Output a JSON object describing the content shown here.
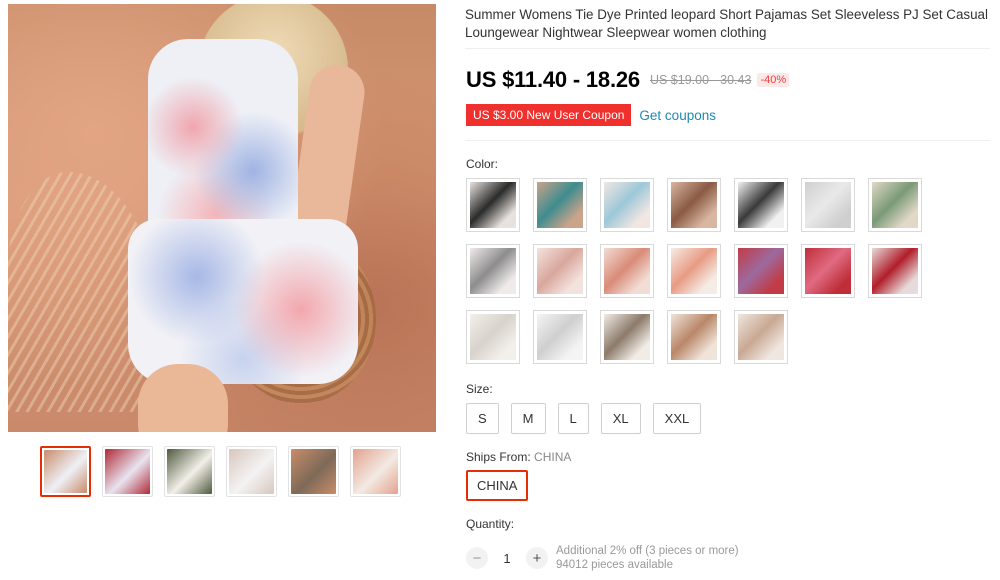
{
  "product": {
    "title": "Summer Womens Tie Dye Printed leopard Short Pajamas Set Sleeveless PJ Set Casual Loungewear Nightwear Sleepwear women clothing",
    "price": "US $11.40 - 18.26",
    "original_price": "US $19.00 - 30.43",
    "discount": "-40%",
    "coupon": "US $3.00 New User Coupon",
    "get_coupons": "Get coupons"
  },
  "color": {
    "label": "Color:",
    "swatches": [
      {
        "name": "black",
        "c1": "#2b2b2b",
        "c2": "#e7e2dd"
      },
      {
        "name": "teal",
        "c1": "#3f8c8f",
        "c2": "#c9a38a"
      },
      {
        "name": "blue-print",
        "c1": "#9cc8d8",
        "c2": "#f1e6e2"
      },
      {
        "name": "leopard",
        "c1": "#8a5a44",
        "c2": "#d8b6a1"
      },
      {
        "name": "black-white",
        "c1": "#3a3a3a",
        "c2": "#f1f1f1"
      },
      {
        "name": "white",
        "c1": "#e9e9e9",
        "c2": "#cfcfcf"
      },
      {
        "name": "green-leaf",
        "c1": "#7a9a76",
        "c2": "#e2d8c8"
      },
      {
        "name": "grey-print",
        "c1": "#8d8d8d",
        "c2": "#f0eaea"
      },
      {
        "name": "pink-leopard",
        "c1": "#d9a79c",
        "c2": "#f3e3de"
      },
      {
        "name": "salmon",
        "c1": "#d98b78",
        "c2": "#f2ddd5"
      },
      {
        "name": "coral",
        "c1": "#e79b83",
        "c2": "#f6ece6"
      },
      {
        "name": "tie-dye-purple",
        "c1": "#9c6a9e",
        "c2": "#c23b46"
      },
      {
        "name": "pink-floral",
        "c1": "#e06b82",
        "c2": "#bf2f3a"
      },
      {
        "name": "red",
        "c1": "#b01e2a",
        "c2": "#e7dada"
      },
      {
        "name": "white-print",
        "c1": "#d7d2cc",
        "c2": "#f3efea"
      },
      {
        "name": "light-grey",
        "c1": "#cfcfcf",
        "c2": "#f4f4f4"
      },
      {
        "name": "floral-white",
        "c1": "#8c7a6a",
        "c2": "#f1ece5"
      },
      {
        "name": "tan-leopard",
        "c1": "#b98768",
        "c2": "#f0e3da"
      },
      {
        "name": "beige",
        "c1": "#c9a893",
        "c2": "#efe6e0"
      }
    ]
  },
  "size": {
    "label": "Size:",
    "options": [
      "S",
      "M",
      "L",
      "XL",
      "XXL"
    ]
  },
  "ships": {
    "label": "Ships From:",
    "value": "CHINA",
    "option": "CHINA"
  },
  "quantity": {
    "label": "Quantity:",
    "value": "1",
    "minus": "−",
    "plus": "+",
    "offer": "Additional 2% off (3 pieces or more)",
    "available": "94012 pieces available"
  },
  "gallery": {
    "thumbs": [
      {
        "c1": "#c98c6a",
        "c2": "#eef0f6",
        "active": true
      },
      {
        "c1": "#b02a36",
        "c2": "#e8e4f0",
        "active": false
      },
      {
        "c1": "#4f5a3e",
        "c2": "#f2efe8",
        "active": false
      },
      {
        "c1": "#d9c6bd",
        "c2": "#f3f3f3",
        "active": false
      },
      {
        "c1": "#c98c6a",
        "c2": "#7e6a58",
        "active": false
      },
      {
        "c1": "#e3a28d",
        "c2": "#f3eae4",
        "active": false
      }
    ]
  }
}
